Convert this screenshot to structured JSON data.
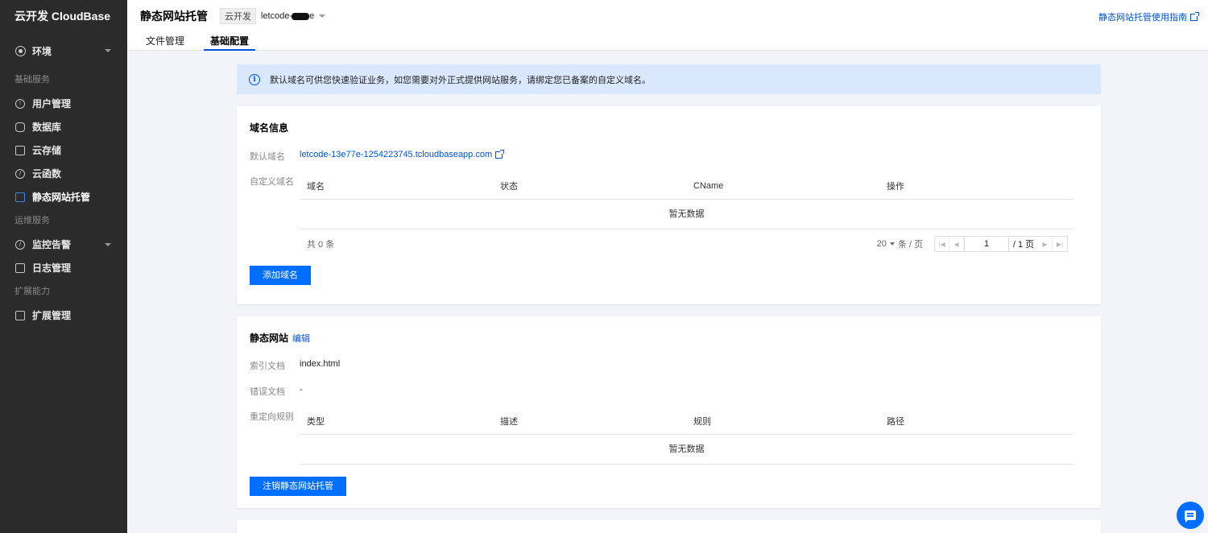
{
  "sidebar": {
    "brand": "云开发 CloudBase",
    "env_label": "环境",
    "groups": [
      {
        "title": "基础服务"
      },
      {
        "title": "运维服务"
      },
      {
        "title": "扩展能力"
      }
    ],
    "items": {
      "users": "用户管理",
      "database": "数据库",
      "storage": "云存储",
      "functions": "云函数",
      "hosting": "静态网站托管",
      "monitor": "监控告警",
      "logs": "日志管理",
      "extensions": "扩展管理"
    }
  },
  "header": {
    "title": "静态网站托管",
    "tag": "云开发",
    "env_name": "letcode-",
    "env_suffix": "e",
    "guide_link": "静态网站托管使用指南",
    "tabs": [
      "文件管理",
      "基础配置"
    ],
    "active_tab": "基础配置"
  },
  "notice": {
    "text": "默认域名可供您快速验证业务，如您需要对外正式提供网站服务，请绑定您已备案的自定义域名。"
  },
  "domain_card": {
    "title": "域名信息",
    "default_domain_label": "默认域名",
    "default_domain_value": "letcode-13e77e-1254223745.tcloudbaseapp.com",
    "custom_domain_label": "自定义域名",
    "columns": [
      "域名",
      "状态",
      "CName",
      "操作"
    ],
    "empty_text": "暂无数据",
    "pager": {
      "total": "共 0 条",
      "page_size": "20",
      "page_size_unit": "条 / 页",
      "current_page": "1",
      "total_pages": "/ 1 页"
    },
    "add_button": "添加域名"
  },
  "site_card": {
    "title": "静态网站",
    "edit_link": "编辑",
    "index_label": "索引文档",
    "index_value": "index.html",
    "error_label": "错误文档",
    "error_value": "-",
    "redirect_label": "重定向规则",
    "columns": [
      "类型",
      "描述",
      "规则",
      "路径"
    ],
    "empty_text": "暂无数据",
    "cancel_button": "注销静态网站托管"
  },
  "colors": {
    "accent": "#006eff",
    "link": "#0052d9",
    "sidebar_bg": "#2b2b2b",
    "notice_bg": "#d9e8fd"
  }
}
